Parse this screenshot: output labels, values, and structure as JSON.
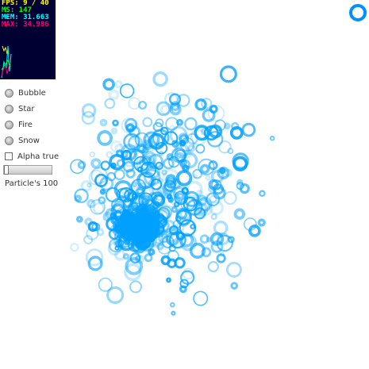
{
  "stats": {
    "fps": "FPS: 9 / 40",
    "ms": "MS: 147",
    "mem": "MEM: 31.663",
    "max": "MAX: 34.986",
    "colors": {
      "fps": "#ffff00",
      "ms": "#00ff00",
      "mem": "#00ffff",
      "max": "#ff0070",
      "bg": "#000033"
    }
  },
  "controls": {
    "modes": [
      {
        "label": "Bubble",
        "selected": false
      },
      {
        "label": "Star",
        "selected": false
      },
      {
        "label": "Fire",
        "selected": false
      },
      {
        "label": "Snow",
        "selected": false
      }
    ],
    "alpha_checkbox": {
      "label": "Alpha true",
      "checked": false
    },
    "particle_slider": {
      "value": 0.0
    },
    "particle_label": "Particle's 100"
  },
  "scene": {
    "particle_color": "#00a0ff",
    "center_indicator": "ring-icon"
  }
}
